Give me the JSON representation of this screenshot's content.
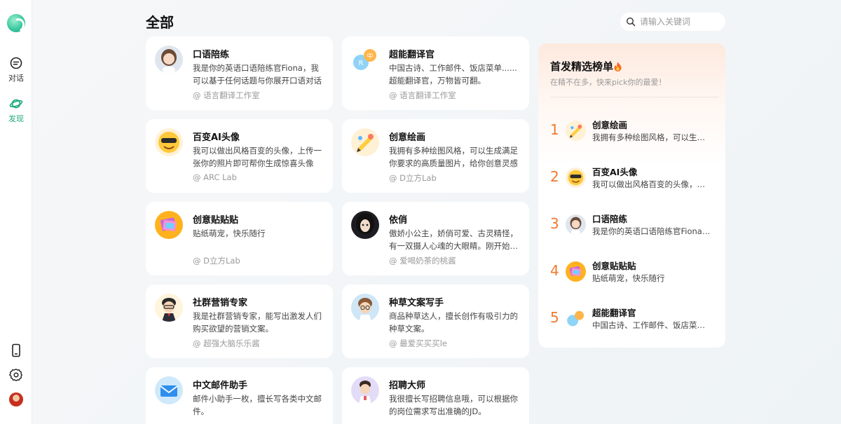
{
  "sidebar": {
    "nav": [
      {
        "label": "对话",
        "icon": "chat-icon"
      },
      {
        "label": "发现",
        "icon": "planet-icon",
        "active": true
      }
    ],
    "bottom": [
      "phone-icon",
      "gear-icon",
      "avatar"
    ],
    "accent": "#1fa97f"
  },
  "header": {
    "title": "全部",
    "search_placeholder": "请输入关键词"
  },
  "cards": [
    {
      "name": "口语陪练",
      "desc": "我是你的英语口语陪练官Fiona，我可以基于任何话题与你展开口语对话",
      "author": "@ 语言翻译工作室"
    },
    {
      "name": "超能翻译官",
      "desc": "中国古诗、工作邮件、饭店菜单......超能翻译官，万物皆可翻。",
      "author": "@ 语言翻译工作室"
    },
    {
      "name": "百变AI头像",
      "desc": "我可以做出风格百变的头像，上传一张你的照片即可帮你生成惊喜头像",
      "author": "@ ARC Lab"
    },
    {
      "name": "创意绘画",
      "desc": "我拥有多种绘图风格，可以生成满足你要求的高质量图片，给你创意灵感",
      "author": "@ D立方Lab"
    },
    {
      "name": "创意贴贴贴",
      "desc": "贴纸萌宠，快乐随行",
      "author": "@ D立方Lab"
    },
    {
      "name": "依俏",
      "desc": "傲娇小公主，娇俏可爱、古灵精怪，有一双摄人心魂的大眼睛。刚开始认识你",
      "author": "@ 爱喝奶茶的桃酱"
    },
    {
      "name": "社群营销专家",
      "desc": "我是社群营销专家，能写出激发人们购买欲望的营销文案。",
      "author": "@ 超强大脑乐乐酱"
    },
    {
      "name": "种草文案写手",
      "desc": "商品种草达人，擅长创作有吸引力的种草文案。",
      "author": "@ 最爱买买买le"
    },
    {
      "name": "中文邮件助手",
      "desc": "邮件小助手一枚，擅长写各类中文邮件。",
      "author": ""
    },
    {
      "name": "招聘大师",
      "desc": "我很擅长写招聘信息哦，可以根据你的岗位需求写出准确的JD。",
      "author": ""
    }
  ],
  "ranking": {
    "title": "首发精选榜单",
    "subtitle": "在精不在多，快来pick你的最爱！",
    "items": [
      {
        "rank": "1",
        "name": "创意绘画",
        "desc": "我拥有多种绘图风格，可以生成满足你要求的高质量图片"
      },
      {
        "rank": "2",
        "name": "百变AI头像",
        "desc": "我可以做出风格百变的头像，上传一张你的照片"
      },
      {
        "rank": "3",
        "name": "口语陪练",
        "desc": "我是你的英语口语陪练官Fiona，我可以基于任何话题"
      },
      {
        "rank": "4",
        "name": "创意贴贴贴",
        "desc": "贴纸萌宠，快乐随行"
      },
      {
        "rank": "5",
        "name": "超能翻译官",
        "desc": "中国古诗、工作邮件、饭店菜单......"
      }
    ],
    "accent": "#f07a2d"
  }
}
